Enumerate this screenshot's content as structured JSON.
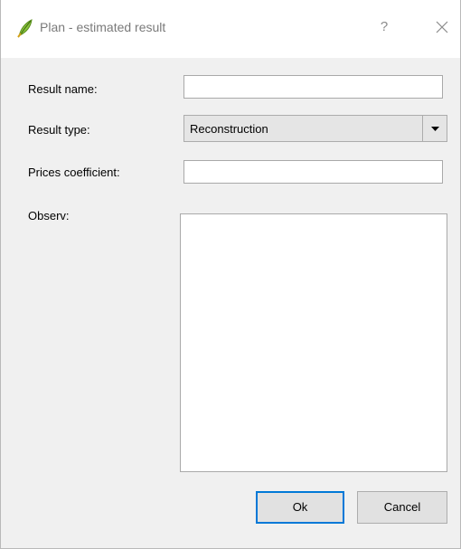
{
  "window": {
    "title": "Plan - estimated result",
    "help_glyph": "?",
    "icon": "qgis-leaf-icon",
    "close_icon": "close-icon"
  },
  "form": {
    "result_name": {
      "label": "Result name:",
      "value": ""
    },
    "result_type": {
      "label": "Result type:",
      "selected": "Reconstruction"
    },
    "prices_coefficient": {
      "label": "Prices coefficient:",
      "value": ""
    },
    "observ": {
      "label": "Observ:",
      "value": ""
    }
  },
  "buttons": {
    "ok": "Ok",
    "cancel": "Cancel"
  },
  "colors": {
    "accent": "#0078d7",
    "window_bg": "#f0f0f0",
    "titlebar_bg": "#ffffff"
  }
}
